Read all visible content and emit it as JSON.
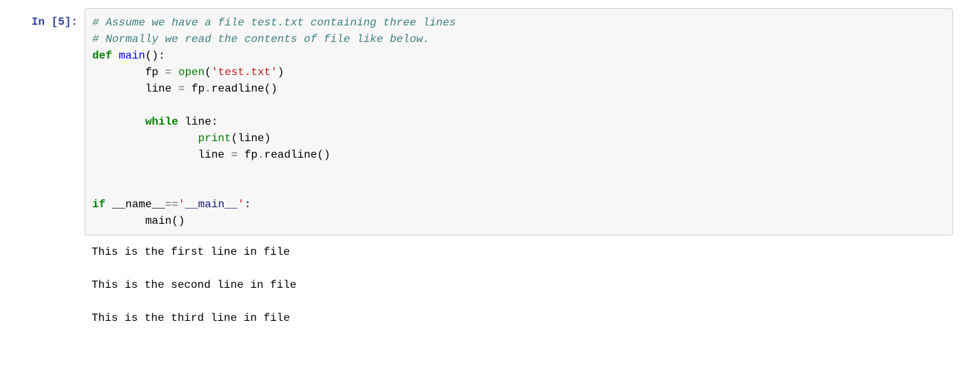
{
  "cell": {
    "prompt": "In [5]:",
    "code": {
      "comment1": "# Assume we have a file test.txt containing three lines",
      "comment2": "# Normally we read the contents of file like below.",
      "def_kw": "def",
      "func_name": "main",
      "paren_colon": "():",
      "indent8": "        ",
      "fp_assign_left": "fp ",
      "eq": "=",
      "sp": " ",
      "open_call": "open",
      "open_paren": "(",
      "string_test": "'test.txt'",
      "close_paren": ")",
      "line_assign_left": "line ",
      "fp_readline": " fp",
      "dot": ".",
      "readline_name": "readline",
      "empty_parens": "()",
      "while_kw": "while",
      "while_rest": " line:",
      "indent16": "                ",
      "print_name": "print",
      "print_arg": "(line)",
      "if_kw": "if",
      "sp2": " ",
      "dunder_name": "__name__",
      "eqeq": "==",
      "string_main_open": "'",
      "dunder_main": "__main__",
      "string_main_close": "'",
      "colon": ":",
      "main_call": "main()"
    },
    "output": {
      "line1": "This is the first line in file",
      "blank": "",
      "line2": "This is the second line in file",
      "line3": "This is the third line in file"
    }
  }
}
